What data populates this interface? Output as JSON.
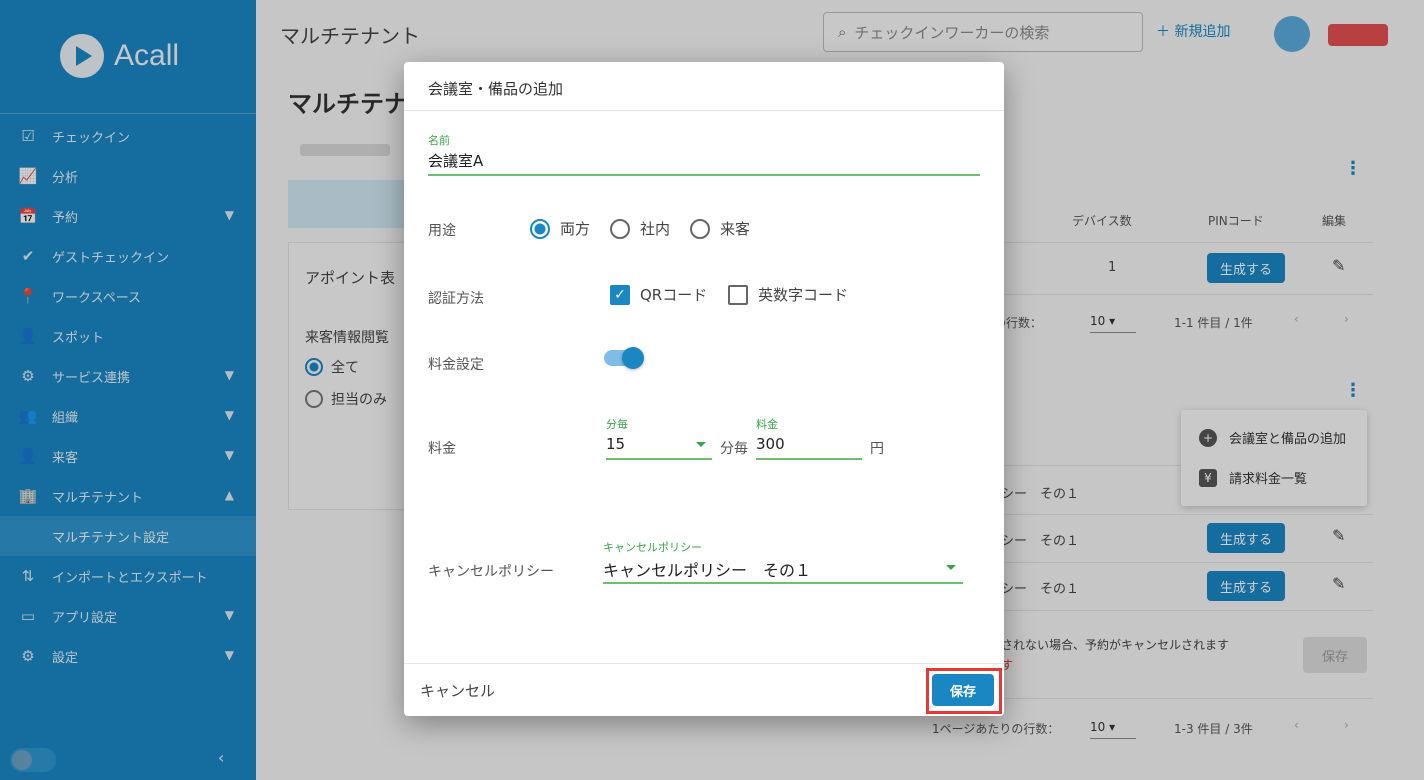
{
  "sidebar": {
    "logo_text": "Acall",
    "items": [
      {
        "label": "チェックイン",
        "icon": "check-box-icon",
        "glyph": "☑",
        "chevron": false
      },
      {
        "label": "分析",
        "icon": "chart-icon",
        "glyph": "📈",
        "chevron": false
      },
      {
        "label": "予約",
        "icon": "calendar-icon",
        "glyph": "📅",
        "chevron": true
      },
      {
        "label": "ゲストチェックイン",
        "icon": "checkmark-icon",
        "glyph": "✔",
        "chevron": false
      },
      {
        "label": "ワークスペース",
        "icon": "location-pin-icon",
        "glyph": "📍",
        "chevron": false
      },
      {
        "label": "スポット",
        "icon": "person-pin-icon",
        "glyph": "👤",
        "chevron": false
      },
      {
        "label": "サービス連携",
        "icon": "integration-icon",
        "glyph": "⚙",
        "chevron": true
      },
      {
        "label": "組織",
        "icon": "group-icon",
        "glyph": "👥",
        "chevron": true
      },
      {
        "label": "来客",
        "icon": "visitor-icon",
        "glyph": "👤",
        "chevron": true
      },
      {
        "label": "マルチテナント",
        "icon": "building-icon",
        "glyph": "🏢",
        "chevron": true,
        "expanded": true
      }
    ],
    "sub_item": "マルチテナント設定",
    "items_after": [
      {
        "label": "インポートとエクスポート",
        "icon": "import-export-icon",
        "glyph": "⇅",
        "chevron": false
      },
      {
        "label": "アプリ設定",
        "icon": "tablet-icon",
        "glyph": "▭",
        "chevron": true
      },
      {
        "label": "設定",
        "icon": "settings-icon",
        "glyph": "⚙",
        "chevron": true
      }
    ],
    "collapse_glyph": "‹"
  },
  "topbar": {
    "title": "マルチテナント",
    "search_placeholder": "チェックインワーカーの検索",
    "new_add": "新規追加"
  },
  "page": {
    "title": "マルチテナ",
    "card_title": "アポイント表",
    "card_sub": "来客情報閲覧",
    "radio_all": "全て",
    "radio_only": "担当のみ"
  },
  "table": {
    "headers": {
      "devices": "デバイス数",
      "pin": "PINコード",
      "edit": "編集"
    },
    "row1_devices": "1",
    "generate_label": "生成する",
    "rows_per_page_label": "の行数：",
    "rows_per_page_label_full": "1ページあたりの行数：",
    "rows_value": "10",
    "range1": "1-1 件目 / 1件",
    "range2": "1-3 件目 / 3件",
    "policy_text": "シー　その１",
    "warn_text": "されない場合、予約がキャンセルされます",
    "warn_red": "す",
    "save_disabled": "保存"
  },
  "popup_menu": {
    "item1": "会議室と備品の追加",
    "item2": "請求料金一覧"
  },
  "dialog": {
    "title": "会議室・備品の追加",
    "name_label": "名前",
    "name_value": "会議室A",
    "usage_label": "用途",
    "usage_options": [
      "両方",
      "社内",
      "来客"
    ],
    "usage_selected": "両方",
    "auth_label": "認証方法",
    "auth_options": [
      {
        "label": "QRコード",
        "checked": true
      },
      {
        "label": "英数字コード",
        "checked": false
      }
    ],
    "fee_setting_label": "料金設定",
    "fee_setting_on": true,
    "fee_label": "料金",
    "per_label": "分毎",
    "per_value": "15",
    "per_unit": "分毎",
    "price_label": "料金",
    "price_value": "300",
    "price_unit": "円",
    "cancel_policy_label": "キャンセルポリシー",
    "cancel_policy_small": "キャンセルポリシー",
    "cancel_policy_value": "キャンセルポリシー　その１",
    "cancel_button": "キャンセル",
    "save_button": "保存"
  },
  "colors": {
    "primary": "#1a86c2",
    "accent_green": "#3ba34a",
    "highlight": "#e53935"
  }
}
